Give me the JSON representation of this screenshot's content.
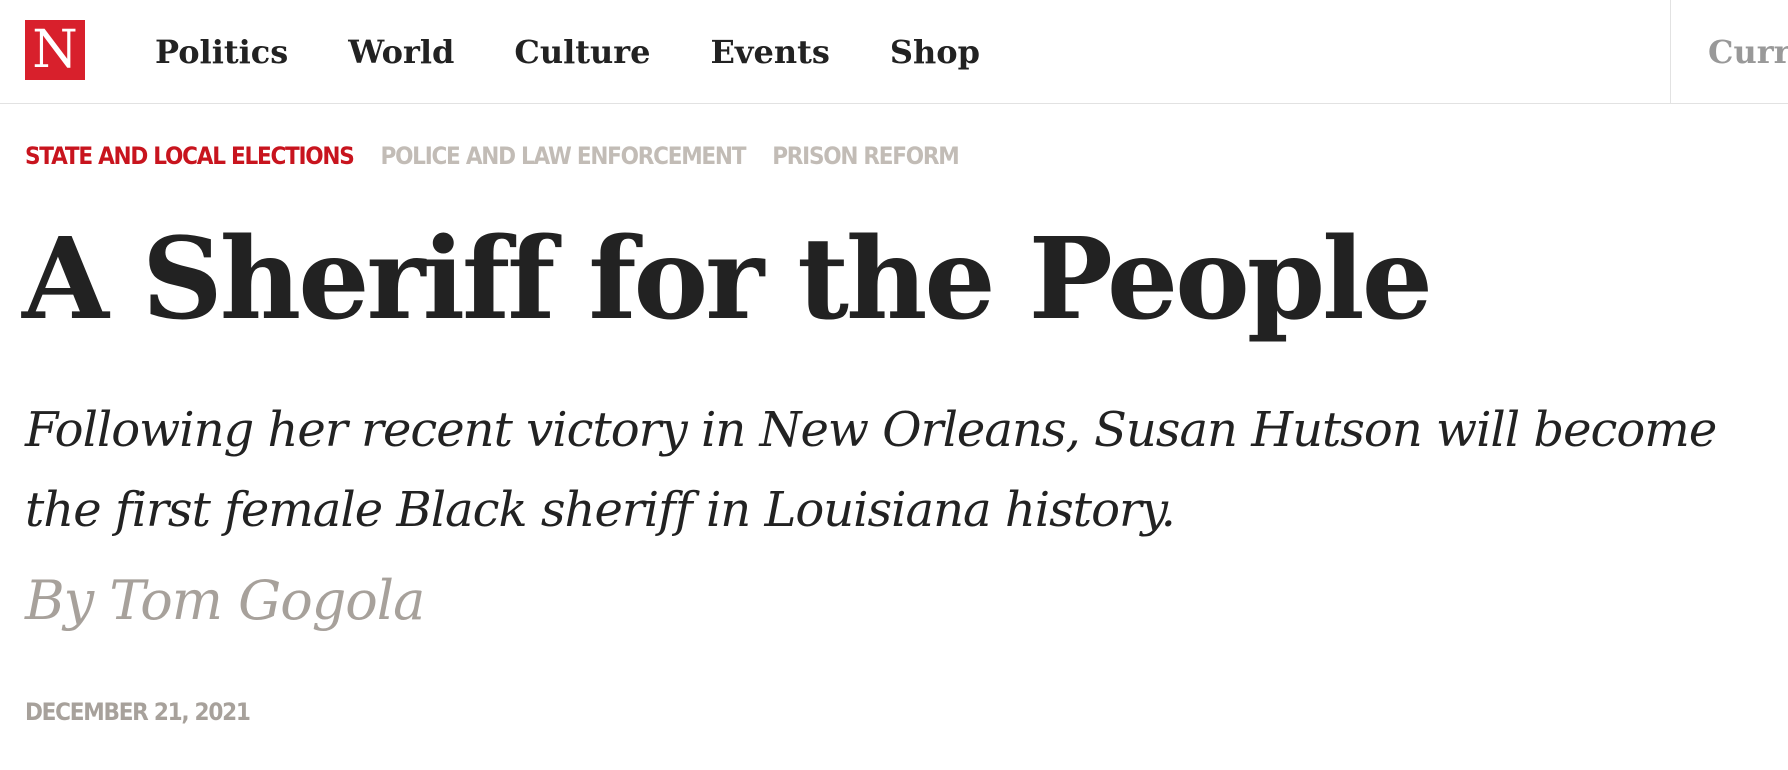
{
  "header": {
    "logo_letter": "N",
    "logo_color": "#d8202c",
    "nav": [
      {
        "label": "Politics"
      },
      {
        "label": "World"
      },
      {
        "label": "Culture"
      },
      {
        "label": "Events"
      },
      {
        "label": "Shop"
      }
    ],
    "current_issue_label": "Curre"
  },
  "article": {
    "tags": [
      {
        "label": "STATE AND LOCAL ELECTIONS",
        "color": "#c8141e"
      },
      {
        "label": "POLICE AND LAW ENFORCEMENT",
        "color": "#c2bcb6"
      },
      {
        "label": "PRISON REFORM",
        "color": "#c2bcb6"
      }
    ],
    "headline": "A Sheriff for the People",
    "dek": "Following her recent victory in New Orleans, Susan Hutson will become the first female Black sheriff in Louisiana history.",
    "byline_prefix": "By",
    "author": "Tom Gogola",
    "date": "DECEMBER 21, 2021"
  }
}
